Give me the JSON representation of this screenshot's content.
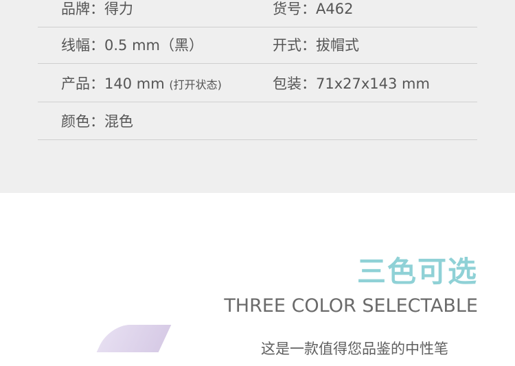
{
  "specs": [
    {
      "left_label": "品牌：",
      "left_value": "得力",
      "right_label": "货号：",
      "right_value": "A462"
    },
    {
      "left_label": "线幅：",
      "left_value": "0.5 mm（黑）",
      "right_label": "开式：",
      "right_value": "拔帽式"
    },
    {
      "left_label": "产品：",
      "left_value": "140 mm",
      "left_note": "(打开状态)",
      "right_label": "包装：",
      "right_value": "71x27x143 mm"
    },
    {
      "left_label": "颜色：",
      "left_value": "混色"
    }
  ],
  "feature": {
    "title_cn": "三色可选",
    "title_en": "THREE COLOR SELECTABLE",
    "description": "这是一款值得您品鉴的中性笔"
  },
  "colors": {
    "accent": "#8fd1d6",
    "panel_bg": "#efefef",
    "pen": "#ddd3ec"
  }
}
